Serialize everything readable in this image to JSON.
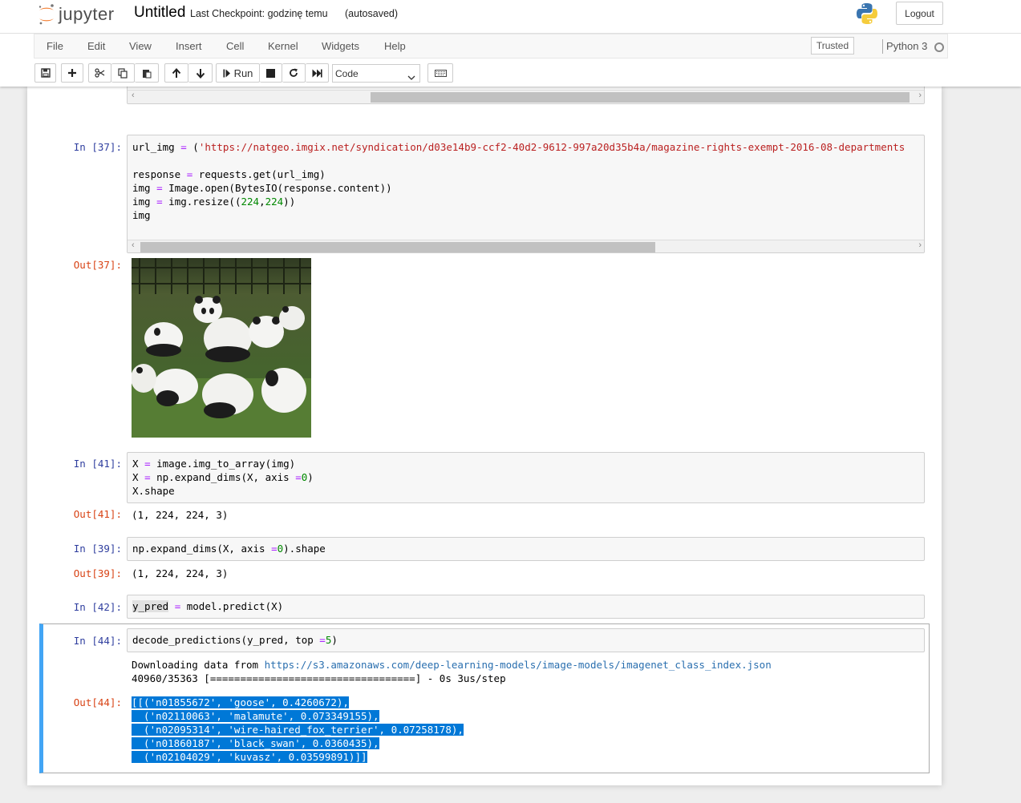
{
  "header": {
    "logo_text": "jupyter",
    "notebook_title": "Untitled",
    "checkpoint_text": "Last Checkpoint: godzinę temu",
    "autosave_text": "(autosaved)",
    "logout_label": "Logout"
  },
  "menubar": {
    "items": [
      "File",
      "Edit",
      "View",
      "Insert",
      "Cell",
      "Kernel",
      "Widgets",
      "Help"
    ],
    "trusted_label": "Trusted",
    "kernel_name": "Python 3"
  },
  "toolbar": {
    "run_label": "Run",
    "cell_type": "Code",
    "icons": [
      "save-icon",
      "plus-icon",
      "cut-icon",
      "copy-icon",
      "paste-icon",
      "arrow-up-icon",
      "arrow-down-icon",
      "run-icon",
      "stop-icon",
      "restart-icon",
      "fast-forward-icon",
      "keyboard-icon"
    ]
  },
  "cells": {
    "c37": {
      "in_prompt": "In [37]:",
      "out_prompt": "Out[37]:",
      "line1_var": "url_img",
      "line1_op": "=",
      "line1_paren": "(",
      "line1_str": "'https://natgeo.imgix.net/syndication/d03e14b9-ccf2-40d2-9612-997a20d35b4a/magazine-rights-exempt-2016-08-departments",
      "line3_a": "response ",
      "line3_op": "=",
      "line3_b": " requests.get(url_img)",
      "line4_a": "img ",
      "line4_op": "=",
      "line4_b": " Image.open(BytesIO(response.content))",
      "line5_a": "img ",
      "line5_op": "=",
      "line5_b": " img.resize((",
      "line5_n1": "224",
      "line5_c": ",",
      "line5_n2": "224",
      "line5_d": "))",
      "line6": "img"
    },
    "c41": {
      "in_prompt": "In [41]:",
      "out_prompt": "Out[41]:",
      "l1_a": "X ",
      "l1_op": "=",
      "l1_b": " image.img_to_array(img)",
      "l2_a": "X ",
      "l2_op": "=",
      "l2_b": " np.expand_dims(X, axis ",
      "l2_op2": "=",
      "l2_n": "0",
      "l2_c": ")",
      "l3": "X.shape",
      "output": "(1, 224, 224, 3)"
    },
    "c39": {
      "in_prompt": "In [39]:",
      "out_prompt": "Out[39]:",
      "l1_a": "np.expand_dims(X, axis ",
      "l1_op": "=",
      "l1_n": "0",
      "l1_b": ").shape",
      "output": "(1, 224, 224, 3)"
    },
    "c42": {
      "in_prompt": "In [42]:",
      "l1_var": "y_pred",
      "l1_op": "=",
      "l1_b": " model.predict(X)"
    },
    "c44": {
      "in_prompt": "In [44]:",
      "out_prompt": "Out[44]:",
      "l1_a": "decode_predictions(y_pred, top ",
      "l1_op": "=",
      "l1_n": "5",
      "l1_b": ")",
      "stream_prefix": "Downloading data from ",
      "stream_url": "https://s3.amazonaws.com/deep-learning-models/image-models/imagenet_class_index.json",
      "stream_progress": "40960/35363 [==================================] - 0s 3us/step",
      "result_lines": [
        "[[('n01855672', 'goose', 0.4260672),",
        "  ('n02110063', 'malamute', 0.073349155),",
        "  ('n02095314', 'wire-haired_fox_terrier', 0.07258178),",
        "  ('n01860187', 'black_swan', 0.0360435),",
        "  ('n02104029', 'kuvasz', 0.03599891)]]"
      ]
    }
  }
}
